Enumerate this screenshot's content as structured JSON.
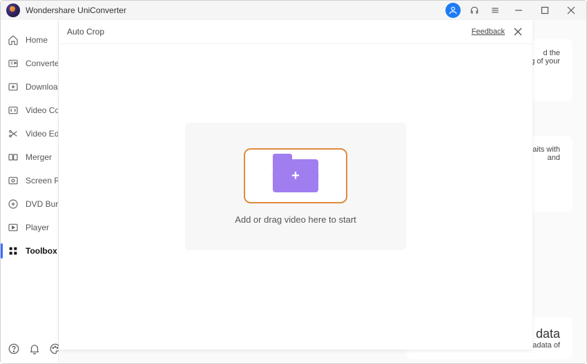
{
  "app": {
    "title": "Wondershare UniConverter"
  },
  "titlebar": {},
  "sidebar": {
    "items": [
      {
        "label": "Home"
      },
      {
        "label": "Converter"
      },
      {
        "label": "Downloader"
      },
      {
        "label": "Video Compressor"
      },
      {
        "label": "Video Editor"
      },
      {
        "label": "Merger"
      },
      {
        "label": "Screen Recorder"
      },
      {
        "label": "DVD Burner"
      },
      {
        "label": "Player"
      },
      {
        "label": "Toolbox"
      }
    ]
  },
  "modal": {
    "title": "Auto Crop",
    "feedback": "Feedback",
    "dropzone_label": "Add or drag video here to start"
  },
  "background": {
    "card1_line1": "d the",
    "card1_line2": "ng of your",
    "card2_line1": "aits with",
    "card2_line2": "and",
    "card3_title": "data",
    "card3_sub": "etadata of"
  }
}
